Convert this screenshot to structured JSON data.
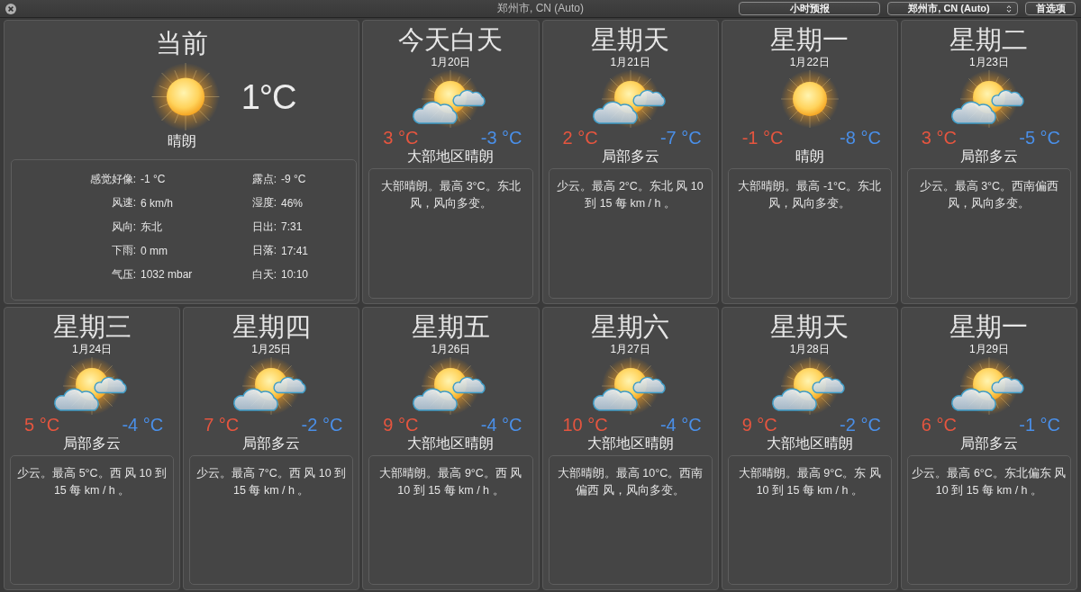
{
  "window": {
    "title": "郑州市, CN (Auto)"
  },
  "toolbar": {
    "hourly_button": "小时预报",
    "location_select": "郑州市, CN (Auto)",
    "preferences_button": "首选项"
  },
  "current": {
    "heading": "当前",
    "kind": "clear",
    "temperature": "1°C",
    "condition": "晴朗",
    "details": [
      {
        "label": "感觉好像:",
        "value": "-1 °C"
      },
      {
        "label": "露点:",
        "value": "-9 °C"
      },
      {
        "label": "风速:",
        "value": "6 km/h"
      },
      {
        "label": "湿度:",
        "value": "46%"
      },
      {
        "label": "风向:",
        "value": "东北"
      },
      {
        "label": "日出:",
        "value": "7:31"
      },
      {
        "label": "下雨:",
        "value": "0 mm"
      },
      {
        "label": "日落:",
        "value": "17:41"
      },
      {
        "label": "气压:",
        "value": "1032 mbar"
      },
      {
        "label": "白天:",
        "value": "10:10"
      }
    ]
  },
  "forecast": [
    {
      "day": "今天白天",
      "date": "1月20日",
      "kind": "partly_cloudy",
      "high": "3 °C",
      "low": "-3 °C",
      "condition": "大部地区晴朗",
      "description": "大部晴朗。最高 3°C。东北风，风向多变。"
    },
    {
      "day": "星期天",
      "date": "1月21日",
      "kind": "partly_cloudy",
      "high": "2 °C",
      "low": "-7 °C",
      "condition": "局部多云",
      "description": "少云。最高 2°C。东北 风 10 到 15 每 km / h 。"
    },
    {
      "day": "星期一",
      "date": "1月22日",
      "kind": "clear",
      "high": "-1 °C",
      "low": "-8 °C",
      "condition": "晴朗",
      "description": "大部晴朗。最高 -1°C。东北风，风向多变。"
    },
    {
      "day": "星期二",
      "date": "1月23日",
      "kind": "partly_cloudy",
      "high": "3 °C",
      "low": "-5 °C",
      "condition": "局部多云",
      "description": "少云。最高 3°C。西南偏西风，风向多变。"
    },
    {
      "day": "星期三",
      "date": "1月24日",
      "kind": "partly_cloudy",
      "high": "5 °C",
      "low": "-4 °C",
      "condition": "局部多云",
      "description": "少云。最高 5°C。西 风 10 到 15 每 km / h 。"
    },
    {
      "day": "星期四",
      "date": "1月25日",
      "kind": "partly_cloudy",
      "high": "7 °C",
      "low": "-2 °C",
      "condition": "局部多云",
      "description": "少云。最高 7°C。西 风 10 到 15 每 km / h 。"
    },
    {
      "day": "星期五",
      "date": "1月26日",
      "kind": "partly_cloudy",
      "high": "9 °C",
      "low": "-4 °C",
      "condition": "大部地区晴朗",
      "description": "大部晴朗。最高 9°C。西 风 10 到 15 每 km / h 。"
    },
    {
      "day": "星期六",
      "date": "1月27日",
      "kind": "partly_cloudy",
      "high": "10 °C",
      "low": "-4 °C",
      "condition": "大部地区晴朗",
      "description": "大部晴朗。最高 10°C。西南偏西 风，风向多变。"
    },
    {
      "day": "星期天",
      "date": "1月28日",
      "kind": "partly_cloudy",
      "high": "9 °C",
      "low": "-2 °C",
      "condition": "大部地区晴朗",
      "description": "大部晴朗。最高 9°C。东 风 10 到 15 每 km / h 。"
    },
    {
      "day": "星期一",
      "date": "1月29日",
      "kind": "partly_cloudy",
      "high": "6 °C",
      "low": "-1 °C",
      "condition": "局部多云",
      "description": "少云。最高 6°C。东北偏东 风 10 到 15 每 km / h 。"
    }
  ]
}
